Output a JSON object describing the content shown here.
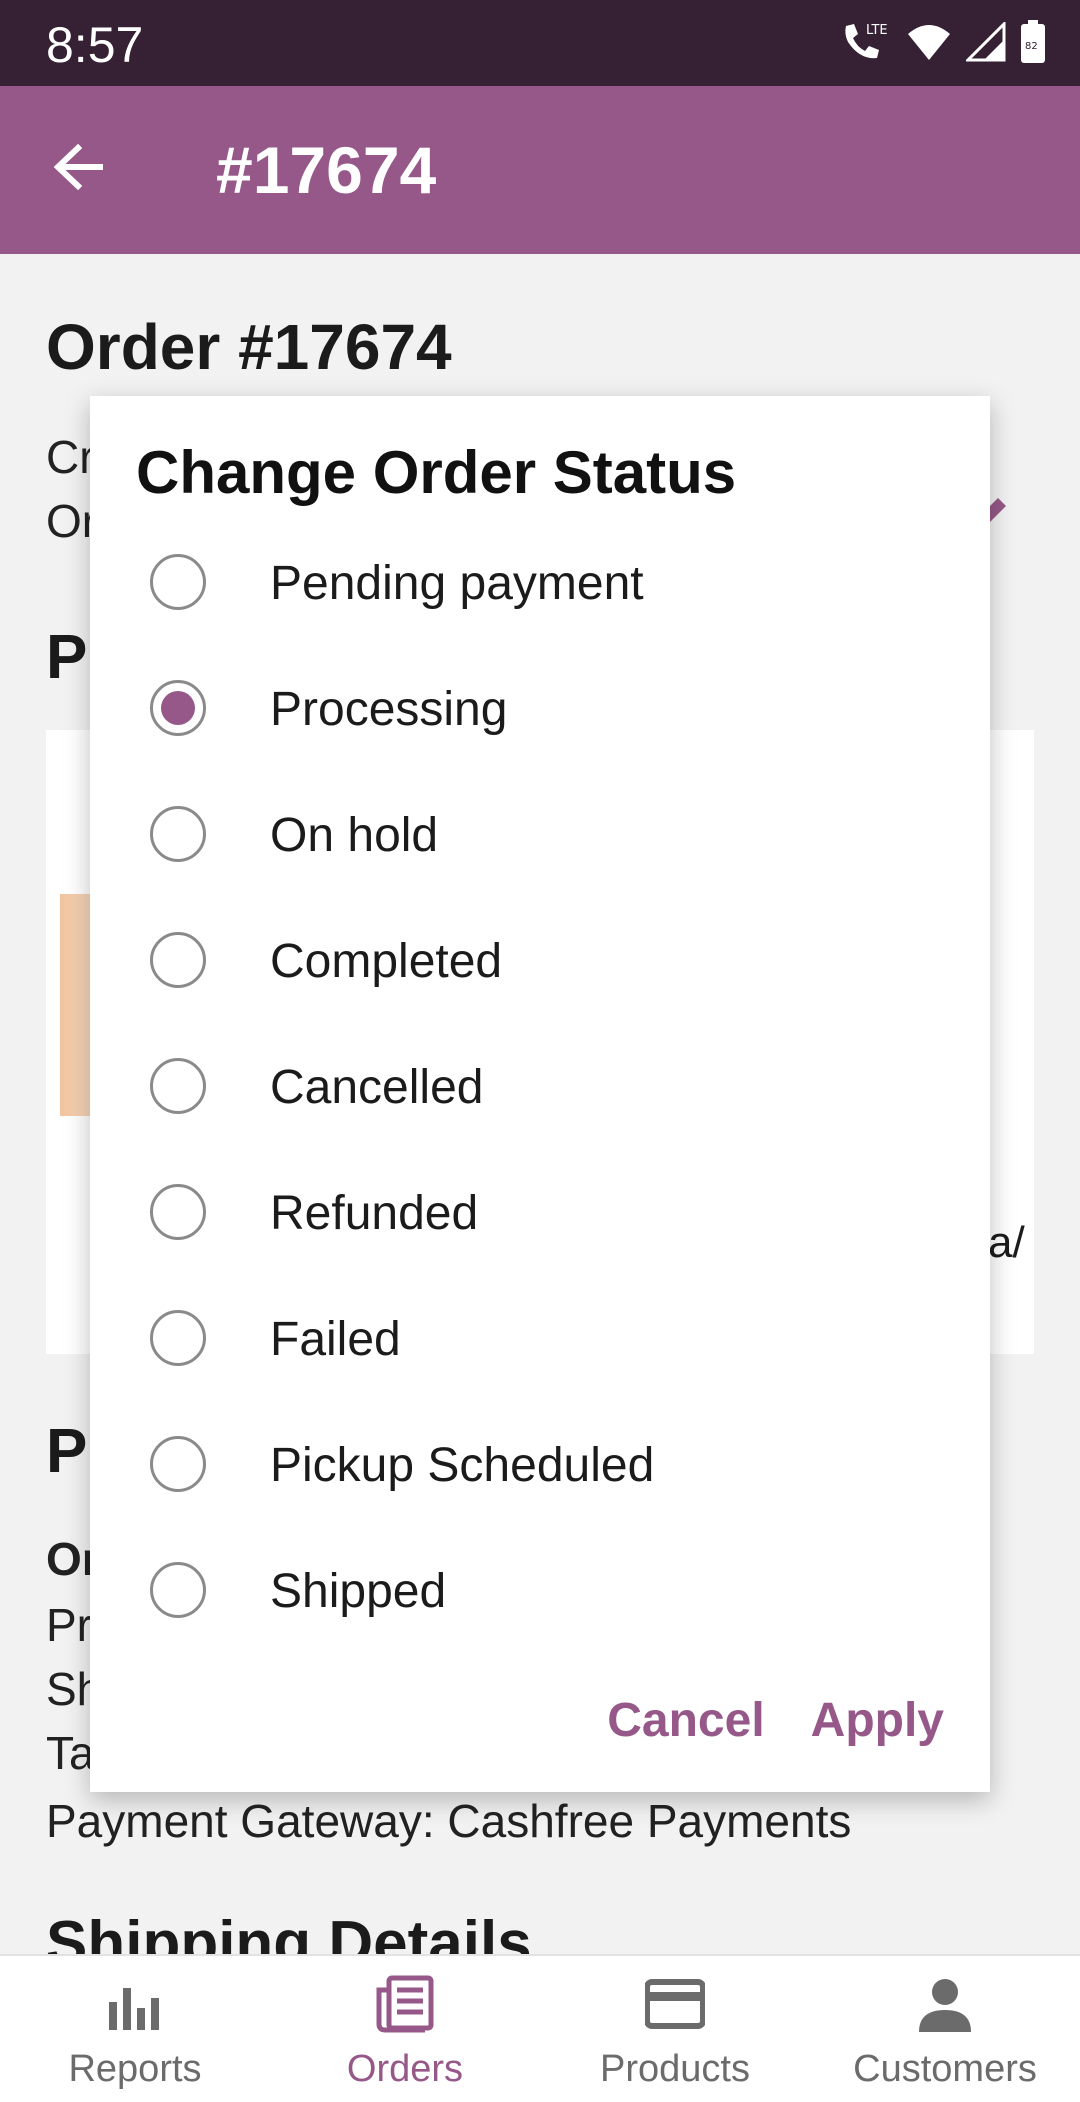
{
  "status_bar": {
    "time": "8:57",
    "battery": "82"
  },
  "app_bar": {
    "title": "#17674"
  },
  "background": {
    "order_heading": "Order #17674",
    "meta_line_1": "Cr",
    "meta_line_2": "Or",
    "section_products_initial": "P",
    "section_payment_initial": "P",
    "payment_line_1": "Or",
    "payment_line_2": "Pr",
    "payment_line_3": "Sh",
    "payment_line_4": "Ta",
    "payment_gateway": "Payment Gateway: Cashfree Payments",
    "shipping_title": "Shipping Details",
    "product_tail": "a/"
  },
  "dialog": {
    "title": "Change Order Status",
    "options": [
      {
        "label": "Pending payment",
        "checked": false
      },
      {
        "label": "Processing",
        "checked": true
      },
      {
        "label": "On hold",
        "checked": false
      },
      {
        "label": "Completed",
        "checked": false
      },
      {
        "label": "Cancelled",
        "checked": false
      },
      {
        "label": "Refunded",
        "checked": false
      },
      {
        "label": "Failed",
        "checked": false
      },
      {
        "label": "Pickup Scheduled",
        "checked": false
      },
      {
        "label": "Shipped",
        "checked": false
      }
    ],
    "cancel_label": "Cancel",
    "apply_label": "Apply"
  },
  "bottom_nav": {
    "items": [
      {
        "label": "Reports",
        "icon": "bar-chart-icon",
        "active": false
      },
      {
        "label": "Orders",
        "icon": "orders-icon",
        "active": true
      },
      {
        "label": "Products",
        "icon": "card-icon",
        "active": false
      },
      {
        "label": "Customers",
        "icon": "person-icon",
        "active": false
      }
    ]
  },
  "colors": {
    "accent": "#965888",
    "status_bar": "#362034",
    "text": "#1b1b1b"
  }
}
